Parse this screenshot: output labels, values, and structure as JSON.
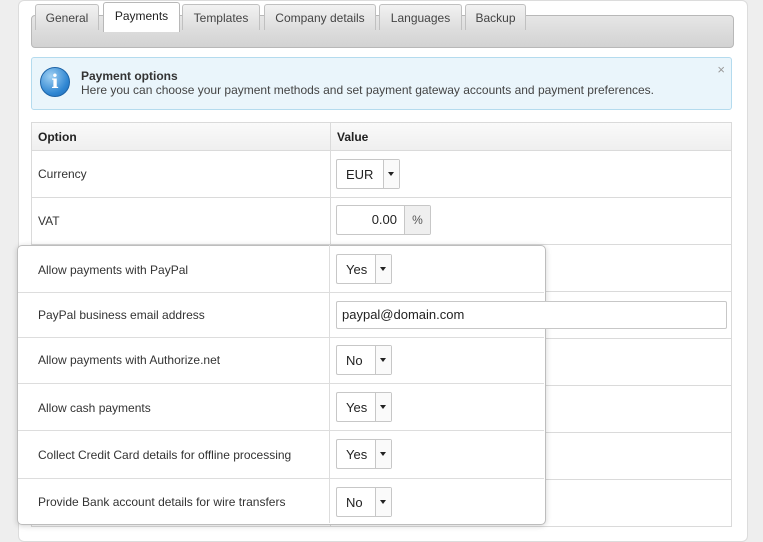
{
  "tabs": [
    {
      "label": "General"
    },
    {
      "label": "Payments"
    },
    {
      "label": "Templates"
    },
    {
      "label": "Company details"
    },
    {
      "label": "Languages"
    },
    {
      "label": "Backup"
    }
  ],
  "active_tab": "Payments",
  "info": {
    "title": "Payment options",
    "description": "Here you can choose your payment methods and set payment gateway accounts and payment preferences.",
    "close": "×",
    "icon_glyph": "i"
  },
  "table": {
    "headers": {
      "option": "Option",
      "value": "Value"
    },
    "currency": {
      "label": "Currency",
      "value": "EUR"
    },
    "vat": {
      "label": "VAT",
      "value": "0.00",
      "unit": "%"
    }
  },
  "popup": {
    "rows": [
      {
        "label": "Allow payments with PayPal",
        "value": "Yes"
      },
      {
        "label": "PayPal business email address",
        "value": "paypal@domain.com"
      },
      {
        "label": "Allow payments with Authorize.net",
        "value": "No"
      },
      {
        "label": "Allow cash payments",
        "value": "Yes"
      },
      {
        "label": "Collect Credit Card details for offline processing",
        "value": "Yes"
      },
      {
        "label": "Provide Bank account details for wire transfers",
        "value": "No"
      }
    ]
  },
  "colors": {
    "info_bg": "#eaf5fb",
    "info_border": "#b4dbee",
    "icon_blue": "#2f86d2"
  }
}
